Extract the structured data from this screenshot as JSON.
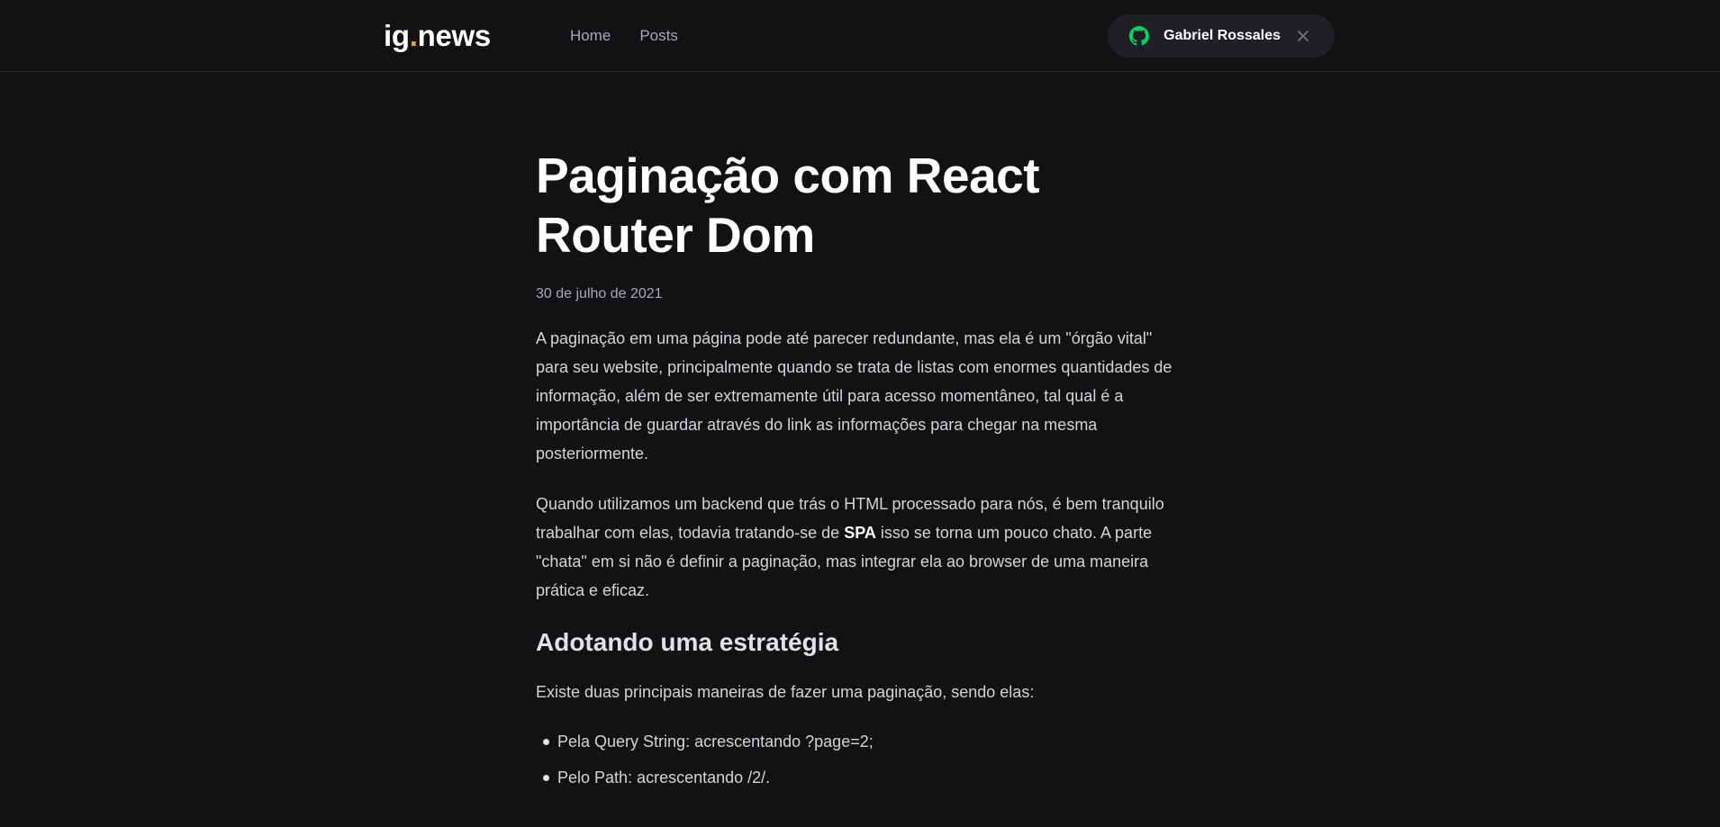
{
  "header": {
    "logo_main": "ig",
    "logo_dot": ".",
    "logo_rest": "news",
    "nav": [
      {
        "label": "Home"
      },
      {
        "label": "Posts"
      }
    ],
    "user": {
      "name": "Gabriel Rossales",
      "icon": "github-icon",
      "close_icon": "close-icon"
    }
  },
  "post": {
    "title": "Paginação com React Router Dom",
    "date": "30 de julho de 2021",
    "paragraph_1": "A paginação em uma página pode até parecer redundante, mas ela é um \"órgão vital\" para seu website, principalmente quando se trata de listas com enormes quantidades de informação, além de ser extremamente útil para acesso momentâneo, tal qual é a importância de guardar através do link as informações para chegar na mesma posteriormente.",
    "paragraph_2_before": "Quando utilizamos um backend que trás o HTML processado para nós, é bem tranquilo trabalhar com elas, todavia tratando-se de ",
    "paragraph_2_strong": "SPA",
    "paragraph_2_after": " isso se torna um pouco chato. A parte \"chata\" em si não é definir a paginação, mas integrar ela ao browser de uma maneira prática e eficaz.",
    "heading_1": "Adotando uma estratégia",
    "paragraph_3": "Existe duas principais maneiras de fazer uma paginação, sendo elas:",
    "list": [
      "Pela Query String: acrescentando ?page=2;",
      "Pelo Path: acrescentando /2/."
    ]
  },
  "colors": {
    "background": "#121214",
    "pill": "#202024",
    "accent_logo": "#eba417",
    "github_green": "#04d361",
    "muted_text": "#a8a8b3"
  }
}
